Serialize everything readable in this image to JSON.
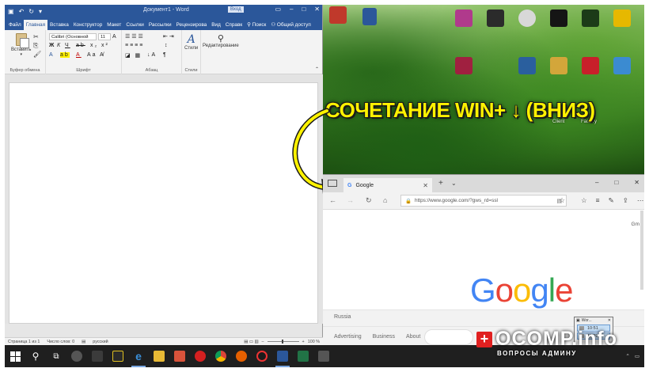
{
  "word": {
    "title": "Документ1 - Word",
    "signin": "Вход",
    "tabs": [
      "Файл",
      "Главная",
      "Вставка",
      "Конструктор",
      "Макет",
      "Ссылки",
      "Рассылки",
      "Рецензирова",
      "Вид",
      "Справк"
    ],
    "search_label": "Поиск",
    "share_label": "Общий доступ",
    "paste_label": "Вставить",
    "font_name": "Calibri (Основной",
    "font_size": "11",
    "styles_label": "Стили",
    "editing_label": "Редактирование",
    "groups": [
      "Буфер обмена",
      "Шрифт",
      "Абзац",
      "Стили"
    ],
    "status": {
      "page": "Страница 1 из 1",
      "words": "Число слов: 0",
      "lang": "русский",
      "zoom": "100 %"
    }
  },
  "desktop": {
    "labels": [
      "Client",
      "Factory"
    ]
  },
  "caption": "СОЧЕТАНИЕ WIN+ ↓ (ВНИЗ)",
  "edge": {
    "tab_title": "Google",
    "url": "https://www.google.com/?gws_rd=ssl",
    "gm_text": "Gm",
    "logo_letters": [
      {
        "ch": "G",
        "color": "#4285f4"
      },
      {
        "ch": "o",
        "color": "#ea4335"
      },
      {
        "ch": "o",
        "color": "#fbbc05"
      },
      {
        "ch": "g",
        "color": "#4285f4"
      },
      {
        "ch": "l",
        "color": "#34a853"
      },
      {
        "ch": "e",
        "color": "#ea4335"
      }
    ],
    "country": "Russia",
    "footer_links": [
      "Advertising",
      "Business",
      "About"
    ]
  },
  "preview": {
    "title": "Wor...",
    "rows": [
      "10:51",
      "11:29"
    ]
  },
  "watermark": {
    "main": "OCOMP.info",
    "sub": "ВОПРОСЫ АДМИНУ"
  },
  "colors": {
    "word_blue": "#2b579a",
    "caption_yellow": "#fff200",
    "taskbar": "#1f1f1f"
  }
}
